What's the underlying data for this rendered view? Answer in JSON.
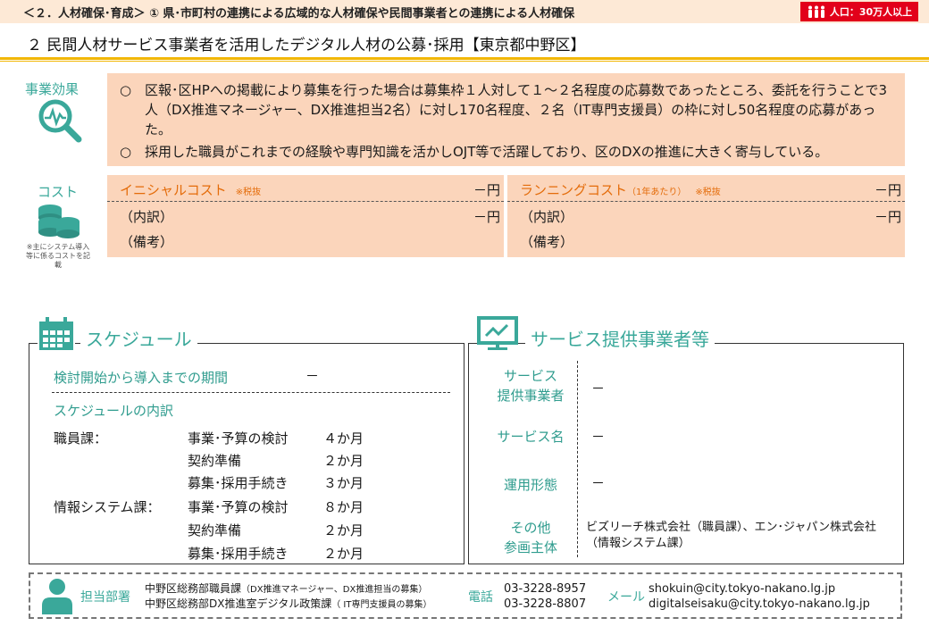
{
  "header": {
    "title": "＜２．人材確保･育成＞ ① 県･市町村の連携による広域的な人材確保や民間事業者との連携による人材確保",
    "population_badge": "人口：30万人以上"
  },
  "subtitle": "２ 民間人材サービス事業者を活用したデジタル人材の公募･採用【東京都中野区】",
  "effect": {
    "label": "事業効果",
    "icon": "magnifier-chart-icon",
    "items": [
      "区報･区HPへの掲載により募集を行った場合は募集枠１人対して１～２名程度の応募数であったところ、委託を行うことで3人（DX推進マネージャー、DX推進担当2名）に対し170名程度、２名（IT専門支援員）の枠に対し50名程度の応募があった。",
      "採用した職員がこれまでの経験や専門知識を活かしOJT等で活躍しており、区のDXの推進に大きく寄与している。"
    ],
    "bullet": "○"
  },
  "cost": {
    "label": "コスト",
    "icon": "coins-icon",
    "note": "※主にシステム導入等に係るコストを記載",
    "initial": {
      "name": "イニシャルコスト",
      "tax": "※税抜",
      "value": "－円",
      "breakdown_label": "（内訳）",
      "breakdown_value": "－円",
      "remarks_label": "（備考）"
    },
    "running": {
      "name": "ランニングコスト",
      "per_year": "（1年あたり）",
      "tax": "※税抜",
      "value": "－円",
      "breakdown_label": "（内訳）",
      "breakdown_value": "－円",
      "remarks_label": "（備考）"
    }
  },
  "schedule": {
    "title": "スケジュール",
    "icon": "calendar-icon",
    "period_label": "検討開始から導入までの期間",
    "period_value": "－",
    "breakdown_title": "スケジュールの内訳",
    "groups": [
      {
        "dept": "職員課：",
        "rows": [
          {
            "task": "事業･予算の検討",
            "duration": "４か月"
          },
          {
            "task": "契約準備",
            "duration": "２か月"
          },
          {
            "task": "募集･採用手続き",
            "duration": "３か月"
          }
        ]
      },
      {
        "dept": "情報システム課：",
        "rows": [
          {
            "task": "事業･予算の検討",
            "duration": "８か月"
          },
          {
            "task": "契約準備",
            "duration": "２か月"
          },
          {
            "task": "募集･採用手続き",
            "duration": "２か月"
          }
        ]
      }
    ]
  },
  "vendor": {
    "title": "サービス提供事業者等",
    "icon": "presentation-screen-icon",
    "rows": [
      {
        "label_line1": "サービス",
        "label_line2": "提供事業者",
        "value": "－"
      },
      {
        "label_line1": "サービス名",
        "label_line2": "",
        "value": "－"
      },
      {
        "label_line1": "運用形態",
        "label_line2": "",
        "value": "－"
      },
      {
        "label_line1": "その他",
        "label_line2": "参画主体",
        "value": "ビズリーチ株式会社（職員課）、エン･ジャパン株式会社（情報システム課）"
      }
    ]
  },
  "contact": {
    "icon": "person-icon",
    "dept_label": "担当部署",
    "depts": [
      {
        "name": "中野区総務部職員課",
        "note": "（DX推進マネージャー、DX推進担当の募集）"
      },
      {
        "name": "中野区総務部DX推進室デジタル政策課",
        "note": "（ IT専門支援員の募集）"
      }
    ],
    "phone_label": "電話",
    "phones": [
      "03-3228-8957",
      "03-3228-8807"
    ],
    "mail_label": "メール",
    "mails": [
      "shokuin@city.tokyo-nakano.lg.jp",
      "digitalseisaku@city.tokyo-nakano.lg.jp"
    ]
  },
  "colors": {
    "accent_teal": "#3aa89a",
    "effect_bg": "#fbd5bb",
    "header_bg": "#fde9d6",
    "gold": "#f2b705",
    "badge_red": "#e2001a",
    "cost_orange": "#e46c0a"
  }
}
